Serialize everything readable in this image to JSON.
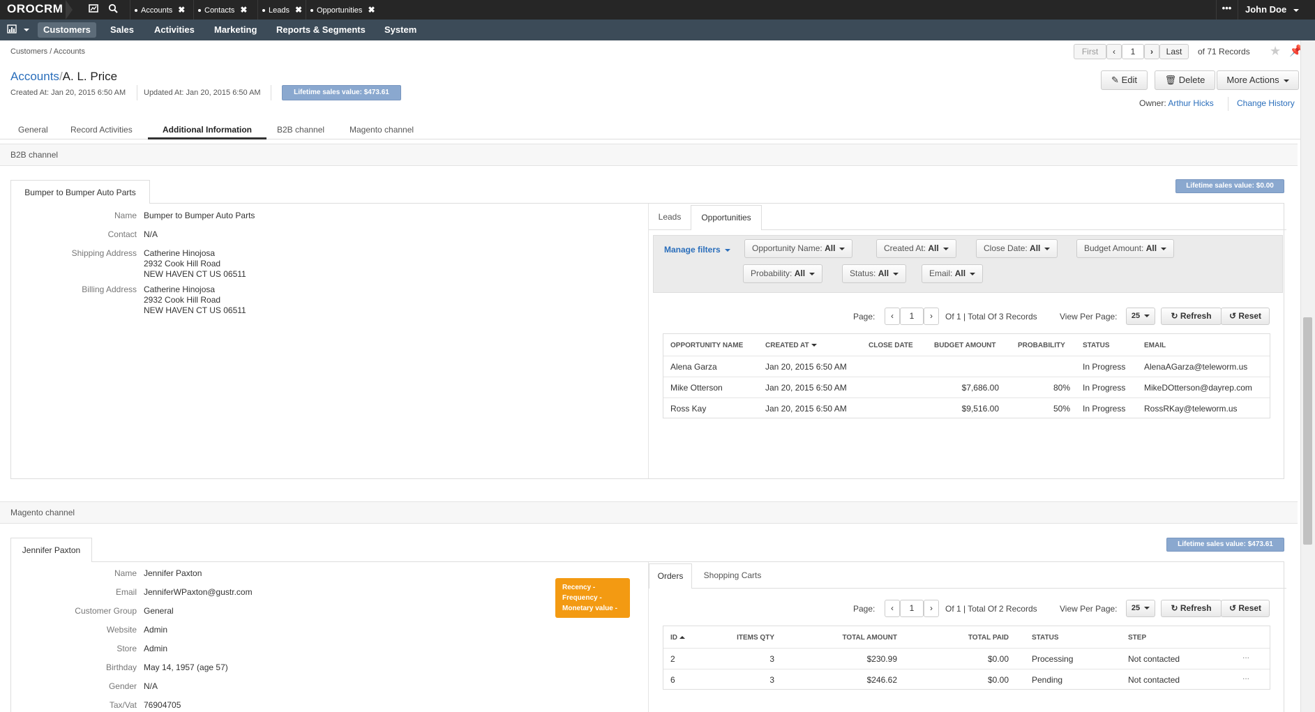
{
  "app": {
    "logo": "OROCRM",
    "user": "John Doe"
  },
  "pinned_tabs": [
    "Accounts",
    "Contacts",
    "Leads",
    "Opportunities"
  ],
  "nav": {
    "items": [
      "Customers",
      "Sales",
      "Activities",
      "Marketing",
      "Reports & Segments",
      "System"
    ],
    "active": "Customers"
  },
  "breadcrumb": "Customers / Accounts",
  "pager": {
    "first": "First",
    "page": "1",
    "last": "Last",
    "total": "of 71 Records"
  },
  "title": {
    "parent": "Accounts",
    "separator": "/",
    "name": "A. L. Price"
  },
  "meta": {
    "created": "Created At: Jan 20, 2015 6:50 AM",
    "updated": "Updated At: Jan 20, 2015 6:50 AM",
    "lifetime": "Lifetime sales value: $473.61"
  },
  "actions": {
    "edit": "Edit",
    "delete": "Delete",
    "more": "More Actions"
  },
  "owner": {
    "label": "Owner:",
    "name": "Arthur Hicks",
    "history": "Change History"
  },
  "tabs": [
    "General",
    "Record Activities",
    "Additional Information",
    "B2B channel",
    "Magento channel"
  ],
  "b2b": {
    "section": "B2B channel",
    "customer_tab": "Bumper to Bumper Auto Parts",
    "lifetime": "Lifetime sales value: $0.00",
    "fields": [
      {
        "label": "Name",
        "value": "Bumper to Bumper Auto Parts",
        "link": true
      },
      {
        "label": "Contact",
        "value": "N/A"
      },
      {
        "label": "Shipping Address",
        "lines": [
          "Catherine Hinojosa",
          "2932 Cook Hill Road",
          "NEW HAVEN CT US 06511"
        ]
      },
      {
        "label": "Billing Address",
        "lines": [
          "Catherine Hinojosa",
          "2932 Cook Hill Road",
          "NEW HAVEN CT US 06511"
        ]
      }
    ],
    "subtabs": [
      "Leads",
      "Opportunities"
    ],
    "filters": {
      "manage": "Manage filters",
      "items": [
        {
          "label": "Opportunity Name:",
          "value": "All"
        },
        {
          "label": "Created At:",
          "value": "All"
        },
        {
          "label": "Close Date:",
          "value": "All"
        },
        {
          "label": "Budget Amount:",
          "value": "All"
        },
        {
          "label": "Probability:",
          "value": "All"
        },
        {
          "label": "Status:",
          "value": "All"
        },
        {
          "label": "Email:",
          "value": "All"
        }
      ]
    },
    "grid_pager": {
      "page_label": "Page:",
      "page": "1",
      "of": "Of 1 | Total Of 3 Records",
      "per_page_label": "View Per Page:",
      "per_page": "25",
      "refresh": "Refresh",
      "reset": "Reset"
    },
    "columns": [
      "Opportunity Name",
      "Created At",
      "Close Date",
      "Budget Amount",
      "Probability",
      "Status",
      "Email"
    ],
    "rows": [
      {
        "name": "Alena Garza",
        "created": "Jan 20, 2015 6:50 AM",
        "close": "",
        "budget": "",
        "prob": "",
        "status": "In Progress",
        "email": "AlenaAGarza@teleworm.us"
      },
      {
        "name": "Mike Otterson",
        "created": "Jan 20, 2015 6:50 AM",
        "close": "",
        "budget": "$7,686.00",
        "prob": "80%",
        "status": "In Progress",
        "email": "MikeDOtterson@dayrep.com"
      },
      {
        "name": "Ross Kay",
        "created": "Jan 20, 2015 6:50 AM",
        "close": "",
        "budget": "$9,516.00",
        "prob": "50%",
        "status": "In Progress",
        "email": "RossRKay@teleworm.us"
      }
    ]
  },
  "magento": {
    "section": "Magento channel",
    "customer_tab": "Jennifer Paxton",
    "lifetime": "Lifetime sales value: $473.61",
    "rfm": [
      "Recency -",
      "Frequency -",
      "Monetary value -"
    ],
    "fields": [
      {
        "label": "Name",
        "value": "Jennifer Paxton",
        "link": true
      },
      {
        "label": "Email",
        "value": "JenniferWPaxton@gustr.com",
        "link": true
      },
      {
        "label": "Customer Group",
        "value": "General"
      },
      {
        "label": "Website",
        "value": "Admin"
      },
      {
        "label": "Store",
        "value": "Admin"
      },
      {
        "label": "Birthday",
        "value": "May 14, 1957 (age 57)"
      },
      {
        "label": "Gender",
        "value": "N/A"
      },
      {
        "label": "Tax/Vat",
        "value": "76904705"
      }
    ],
    "subtabs": [
      "Orders",
      "Shopping Carts"
    ],
    "grid_pager": {
      "page_label": "Page:",
      "page": "1",
      "of": "Of 1 | Total Of 2 Records",
      "per_page_label": "View Per Page:",
      "per_page": "25",
      "refresh": "Refresh",
      "reset": "Reset"
    },
    "columns": [
      "ID",
      "Items Qty",
      "Total Amount",
      "Total Paid",
      "Status",
      "Step"
    ],
    "rows": [
      {
        "id": "2",
        "qty": "3",
        "amount": "$230.99",
        "paid": "$0.00",
        "status": "Processing",
        "step": "Not contacted",
        "more": "..."
      },
      {
        "id": "6",
        "qty": "3",
        "amount": "$246.62",
        "paid": "$0.00",
        "status": "Pending",
        "step": "Not contacted",
        "more": "..."
      }
    ]
  }
}
